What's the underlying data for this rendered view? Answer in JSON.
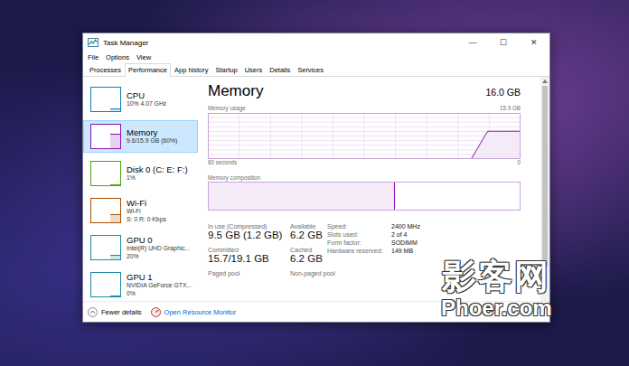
{
  "window": {
    "title": "Task Manager",
    "controls": [
      "—",
      "☐",
      "✕"
    ]
  },
  "menu": [
    "File",
    "Options",
    "View"
  ],
  "tabs": [
    {
      "label": "Processes",
      "selected": false
    },
    {
      "label": "Performance",
      "selected": true
    },
    {
      "label": "App history",
      "selected": false
    },
    {
      "label": "Startup",
      "selected": false
    },
    {
      "label": "Users",
      "selected": false
    },
    {
      "label": "Details",
      "selected": false
    },
    {
      "label": "Services",
      "selected": false
    }
  ],
  "sidebar": {
    "items": [
      {
        "name": "CPU",
        "lines": [
          "10% 4.07 GHz"
        ],
        "selected": false,
        "level": 0.1,
        "color": "#117dbb"
      },
      {
        "name": "Memory",
        "lines": [
          "9.6/15.9 GB (60%)"
        ],
        "selected": true,
        "level": 0.6,
        "color": "#8b12ae"
      },
      {
        "name": "Disk 0 (C: E: F:)",
        "lines": [
          "1%"
        ],
        "selected": false,
        "level": 0.02,
        "color": "#4da60c"
      },
      {
        "name": "Wi-Fi",
        "lines": [
          "Wi-Fi",
          "S: 0 R: 0 Kbps"
        ],
        "selected": false,
        "level": 0.35,
        "color": "#a74f01"
      },
      {
        "name": "GPU 0",
        "lines": [
          "Intel(R) UHD Graphic...",
          "20%"
        ],
        "selected": false,
        "level": 0.2,
        "color": "#1a8da6"
      },
      {
        "name": "GPU 1",
        "lines": [
          "NVIDIA GeForce GTX...",
          "0%"
        ],
        "selected": false,
        "level": 0,
        "color": "#1a8da6"
      }
    ]
  },
  "panel": {
    "title": "Memory",
    "total": "16.0 GB",
    "usage_chart": {
      "label": "Memory usage",
      "max_label": "15.9 GB",
      "x_start": "60 seconds",
      "x_end": "0",
      "max_value": 15.9,
      "values": [
        0,
        0,
        0,
        0,
        0,
        0,
        0,
        0,
        0,
        0,
        0,
        0,
        0,
        0,
        0,
        0,
        0,
        9.6,
        9.6,
        9.6
      ]
    },
    "composition": {
      "label": "Memory composition",
      "level": 0.6
    },
    "stats": [
      {
        "label": "In use (Compressed)",
        "value": "9.5 GB (1.2 GB)"
      },
      {
        "label": "Available",
        "value": "6.2 GB"
      },
      {
        "label": "Committed",
        "value": "15.7/19.1 GB"
      },
      {
        "label": "Cached",
        "value": "6.2 GB"
      },
      {
        "label": "Paged pool"
      },
      {
        "label": "Non-paged pool"
      }
    ],
    "details": [
      {
        "label": "Speed:",
        "value": "2400 MHz"
      },
      {
        "label": "Slots used:",
        "value": "2 of 4"
      },
      {
        "label": "Form factor:",
        "value": "SODIMM"
      },
      {
        "label": "Hardware reserved:",
        "value": "149 MB"
      }
    ]
  },
  "footer": {
    "fewer": "Fewer details",
    "monitor": "Open Resource Monitor"
  },
  "watermark": {
    "logo": "影客网",
    "site": "Phoer.com"
  }
}
